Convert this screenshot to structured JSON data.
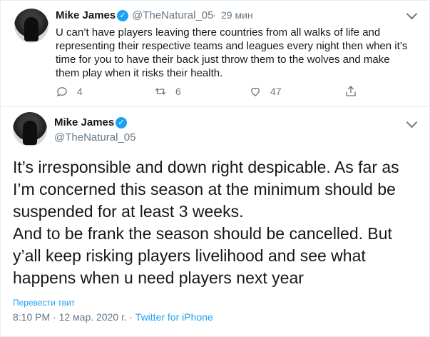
{
  "tweet1": {
    "author_name": "Mike James",
    "handle": "@TheNatural_05",
    "separator": "·",
    "time_ago": "29 мин",
    "text": "U can’t have players leaving there countries from all walks of life and representing their respective teams and leagues every night then when it’s time for you to have their back just throw them to the wolves and make them play when it risks their health.",
    "actions": {
      "reply_count": "4",
      "retweet_count": "6",
      "like_count": "47"
    }
  },
  "tweet2": {
    "author_name": "Mike James",
    "handle": "@TheNatural_05",
    "paragraph1": "It’s irresponsible and down right despicable. As far as I’m concerned this season at the minimum should be suspended for at least 3 weeks.",
    "paragraph2": "And to be frank the season should be cancelled. But y’all keep risking players livelihood and see what happens when u need players next year",
    "translate_label": "Перевести твит",
    "timestamp": "8:10 PM · 12 мар. 2020 г.",
    "meta_separator": "·",
    "source": "Twitter for iPhone"
  },
  "colors": {
    "accent": "#1da1f2",
    "muted": "#657786",
    "text": "#14171a",
    "border": "#e6ecf0"
  },
  "icons": [
    "verified-badge-icon",
    "chevron-down-icon",
    "reply-icon",
    "retweet-icon",
    "like-icon",
    "share-icon"
  ]
}
